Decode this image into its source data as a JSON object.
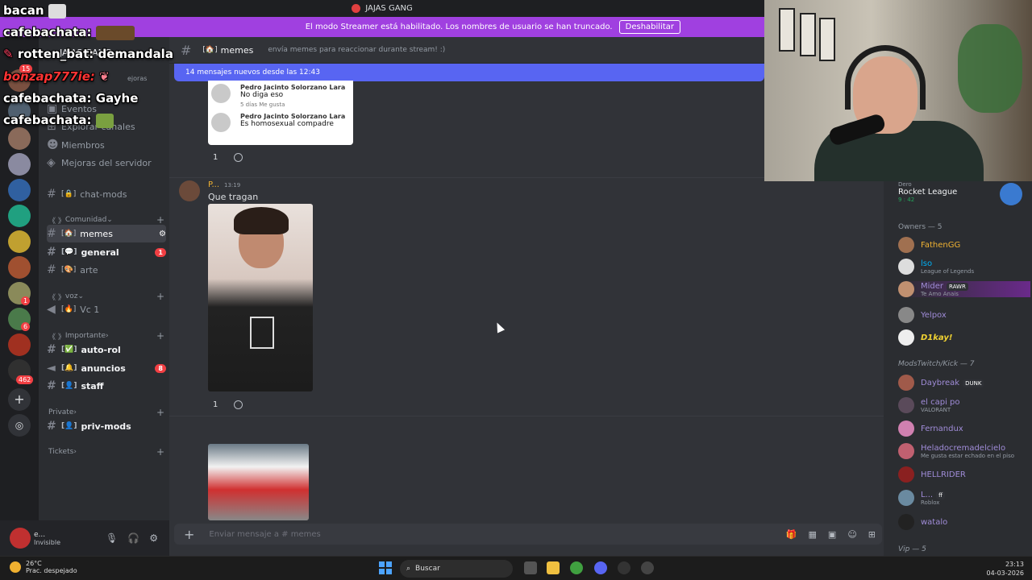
{
  "app": {
    "server_title": "JAJAS GANG"
  },
  "streamer_banner": {
    "text": "El modo Streamer está habilitado. Los nombres de usuario se han truncado.",
    "button": "Deshabilitar"
  },
  "stream_chat": [
    {
      "user": "bacan",
      "message": "",
      "color": "#ffffff"
    },
    {
      "user": "cafebachata:",
      "message": "",
      "color": "#ffffff"
    },
    {
      "user": "rotten_bat:",
      "message": "demandala",
      "color": "#ffffff"
    },
    {
      "user": "bonzap777ie:",
      "message": "",
      "color": "#ff3333"
    },
    {
      "user": "cafebachata:",
      "message": "Gayhe",
      "color": "#ffffff"
    },
    {
      "user": "cafebachata:",
      "message": "",
      "color": "#ffffff"
    }
  ],
  "rail": {
    "badges": [
      "15",
      "1",
      "6",
      "462"
    ]
  },
  "sidebar": {
    "header": "JAJAS GANG",
    "boost_hint": "ejoras",
    "items": [
      {
        "label": "Eventos"
      },
      {
        "label": "Explorar canales"
      },
      {
        "label": "Miembros"
      },
      {
        "label": "Mejoras del servidor"
      }
    ],
    "channels": {
      "chat_mods": "chat-mods",
      "cat_comunidad": "Comunidad",
      "memes": "memes",
      "general": "general",
      "general_badge": "1",
      "arte": "arte",
      "cat_voz": "voz",
      "vc1": "Vc 1",
      "cat_importante": "Importante",
      "auto_rol": "auto-rol",
      "anuncios": "anuncios",
      "anuncios_badge": "8",
      "staff": "staff",
      "cat_private": "Private",
      "priv_mods": "priv-mods",
      "cat_tickets": "Tickets"
    }
  },
  "user_panel": {
    "name": "e...",
    "status": "Invisible"
  },
  "chat": {
    "channel": "memes",
    "topic": "envía memes para reaccionar durante stream! :)",
    "new_messages": "14 mensajes nuevos desde las 12:43",
    "card": {
      "c1_name": "Pedro Jacinto Solorzano Lara",
      "c1_text": "No diga eso",
      "c1_meta": "5 días     Me gusta",
      "c2_name": "Pedro Jacinto Solorzano Lara",
      "c2_text": "Es homosexual compadre"
    },
    "reaction1": "1",
    "msg_author": "P...",
    "msg_time": "13:19",
    "msg_text": "Que tragan",
    "reaction2": "1",
    "input_placeholder": "Enviar mensaje a # memes"
  },
  "members": {
    "top_game": {
      "user": "Dero",
      "game": "Rocket League",
      "time": "9 : 42"
    },
    "owners_header": "Owners — 5",
    "owners": [
      {
        "name": "FathenGG",
        "sub": "",
        "color": "#f0b232"
      },
      {
        "name": "lso",
        "sub": "League of Legends",
        "color": "#00b0f4"
      },
      {
        "name": "Mider",
        "sub": "Te Amo Anais",
        "tag": "RAWR",
        "color": "#a08cd8"
      },
      {
        "name": "Yelpox",
        "sub": "",
        "color": "#a08cd8"
      },
      {
        "name": "D1kay!",
        "sub": "",
        "color": "#f0d232"
      }
    ],
    "mods_header": "ModsTwitch/Kick — 7",
    "mods": [
      {
        "name": "Daybreak",
        "tag": "DUNK",
        "sub": "",
        "color": "#a08cd8"
      },
      {
        "name": "el capi po",
        "sub": "VALORANT",
        "color": "#a08cd8"
      },
      {
        "name": "Fernandux",
        "sub": "",
        "color": "#a08cd8"
      },
      {
        "name": "Heladocremadelcielo",
        "sub": "Me gusta estar echado en el piso",
        "color": "#a08cd8"
      },
      {
        "name": "HELLRIDER",
        "sub": "",
        "color": "#a08cd8"
      },
      {
        "name": "L...",
        "tag": "ff",
        "sub": "Roblox",
        "color": "#a08cd8"
      },
      {
        "name": "watalo",
        "sub": "",
        "color": "#a08cd8"
      }
    ],
    "vip_header": "Vip — 5"
  },
  "taskbar": {
    "temp": "26°C",
    "weather": "Prac. despejado",
    "search": "Buscar",
    "time": "23:13",
    "date": "04-03-2026"
  }
}
